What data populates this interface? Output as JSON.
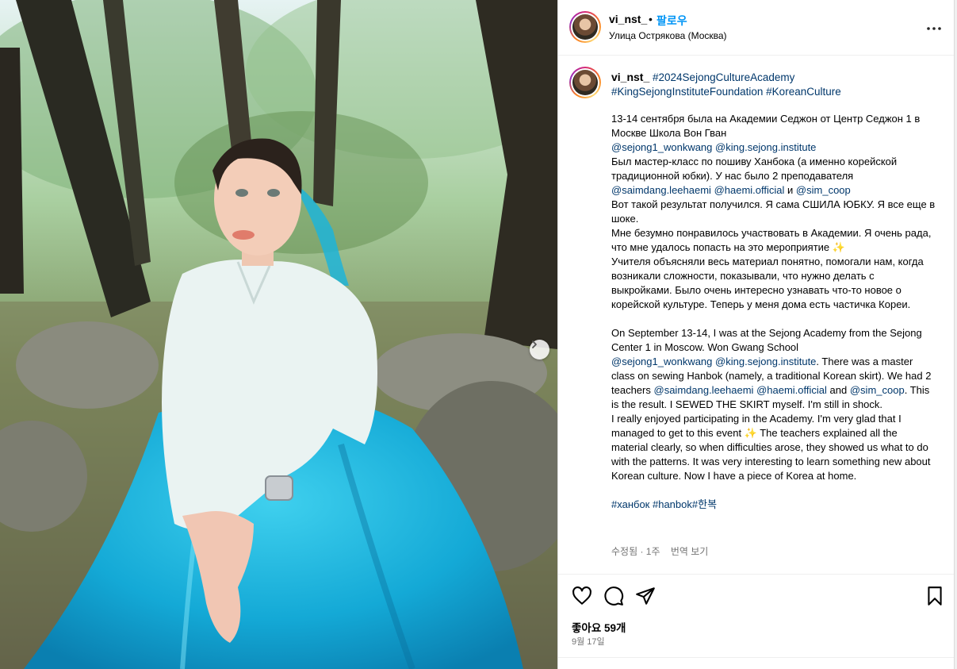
{
  "post": {
    "username": "vi_nst_",
    "separator": "•",
    "follow_label": "팔로우",
    "location": "Улица Острякова (Москва)",
    "more_icon": "more-horizontal-icon"
  },
  "caption": {
    "username": "vi_nst_",
    "hashtags_top": [
      "#2024SejongCultureAcademy",
      "#KingSejongInstituteFoundation",
      "#KoreanCulture"
    ],
    "ru_p1": "13-14 сентября была на Академии Седжон от Центр Седжон 1 в Москве Школа Вон Гван",
    "mention_wonkwang": "@sejong1_wonkwang",
    "mention_king": "@king.sejong.institute",
    "ru_p2": "Был мастер-класс по пошиву Ханбока (а именно корейской традиционной юбки). У нас было 2 преподавателя",
    "mention_saimdang": "@saimdang.leehaemi",
    "mention_haemi": "@haemi.official",
    "ru_and": "и",
    "mention_simcoop": "@sim_coop",
    "ru_p3": "Вот такой результат получился. Я сама СШИЛА ЮБКУ. Я все еще в шоке.",
    "ru_p4": "Мне безумно понравилось участвовать в Академии. Я очень рада, что мне удалось попасть на это мероприятие ✨",
    "ru_p5": "Учителя объясняли весь материал понятно, помогали нам, когда возникали сложности, показывали, что нужно делать с выкройками. Было очень интересно узнавать что-то новое о корейской культуре. Теперь у меня дома есть частичка Кореи.",
    "en_p1": "On September 13-14, I was at the Sejong Academy from the Sejong Center 1 in Moscow. Won Gwang School",
    "en_p2": "There was a master class on sewing Hanbok (namely, a traditional Korean skirt). We had 2 teachers",
    "en_and": "and",
    "en_p3": ". This is the result. I SEWED THE SKIRT myself. I'm still in shock.",
    "en_p4": "I really enjoyed participating in the Academy. I'm very glad that I managed to get to this event ✨ The teachers explained all the material clearly, so when difficulties arose, they showed us what to do with the patterns. It was very interesting to learn something new about Korean culture. Now I have a piece of Korea at home.",
    "hashtags_bottom": [
      "#ханбок",
      "#hanbok",
      "#한복"
    ],
    "edited": "수정됨 · 1주",
    "translate": "번역 보기"
  },
  "actions": {
    "likes": "좋아요 59개",
    "date": "9월 17일"
  }
}
